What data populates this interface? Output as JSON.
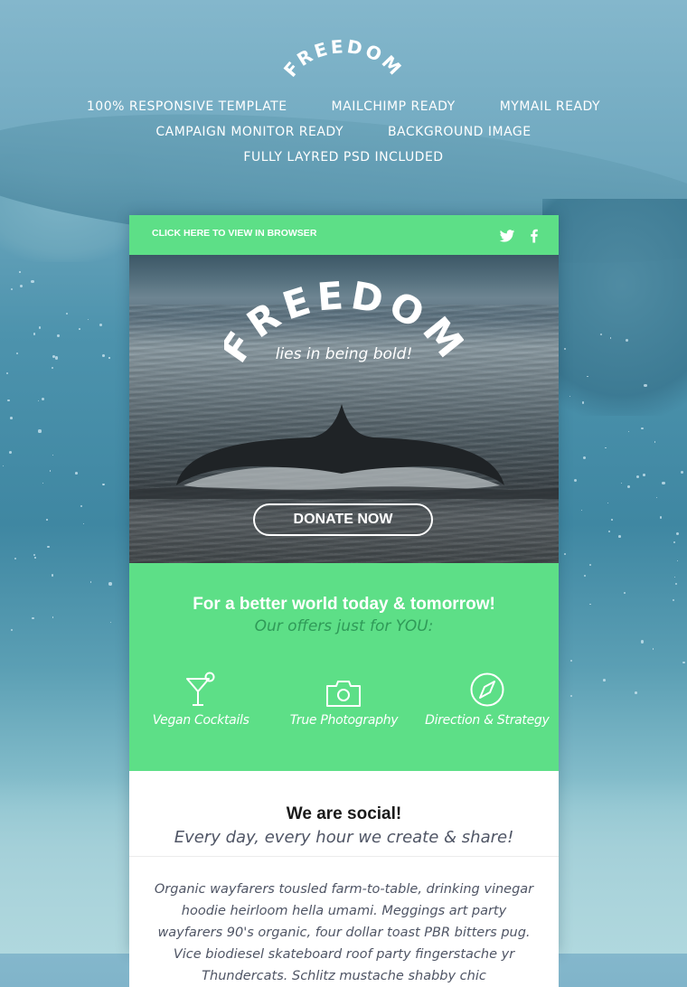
{
  "brand": {
    "logo_text": "FREEDOM",
    "accent_color": "#5ddf87",
    "accent_dark": "#2f9a58"
  },
  "features": {
    "rows": [
      [
        "100% RESPONSIVE TEMPLATE",
        "MAILCHIMP READY",
        "MYMAIL READY"
      ],
      [
        "CAMPAIGN MONITOR READY",
        "BACKGROUND IMAGE"
      ],
      [
        "FULLY LAYRED PSD INCLUDED"
      ]
    ]
  },
  "topbar": {
    "view_in_browser": "CLICK HERE TO VIEW IN BROWSER",
    "social_icons": [
      "twitter-icon",
      "facebook-icon"
    ]
  },
  "hero": {
    "title": "FREEDOM",
    "tagline": "lies in being bold!",
    "button_label": "DONATE NOW"
  },
  "offers": {
    "heading": "For a better world today & tomorrow!",
    "subheading": "Our offers just for YOU:",
    "items": [
      {
        "icon": "cocktail-icon",
        "label": "Vegan Cocktails"
      },
      {
        "icon": "camera-icon",
        "label": "True Photography"
      },
      {
        "icon": "compass-icon",
        "label": "Direction & Strategy"
      }
    ]
  },
  "social": {
    "heading": "We are social!",
    "subheading": "Every day, every hour we create & share!",
    "body": "Organic wayfarers tousled farm-to-table, drinking vinegar hoodie heirloom hella umami. Meggings art party wayfarers 90's organic, four dollar toast PBR bitters pug. Vice biodiesel skateboard roof party fingerstache yr Thundercats. Schlitz mustache shabby chic"
  }
}
